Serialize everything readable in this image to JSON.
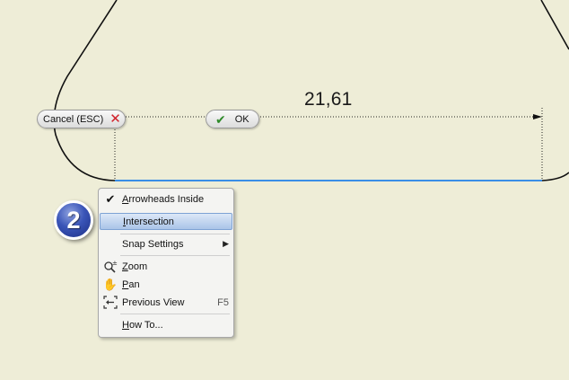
{
  "dimension": {
    "value": "21,61"
  },
  "buttons": {
    "cancel_label": "Cancel (ESC)",
    "ok_label": "OK"
  },
  "step_badge": {
    "number": "2"
  },
  "context_menu": {
    "items": [
      {
        "mnemonic": "A",
        "rest": "rrowheads Inside",
        "checked": true,
        "icon": "checkmark-icon"
      },
      {
        "mnemonic": "I",
        "rest": "ntersection",
        "highlighted": true
      },
      {
        "mnemonic": "",
        "rest": "Snap Settings",
        "submenu": true
      },
      {
        "mnemonic": "Z",
        "rest": "oom",
        "icon": "zoom-icon"
      },
      {
        "mnemonic": "P",
        "rest": "an",
        "icon": "pan-hand-icon"
      },
      {
        "mnemonic": "",
        "rest": "Previous View",
        "shortcut": "F5",
        "icon": "previous-view-icon"
      },
      {
        "mnemonic": "H",
        "rest": "ow To..."
      }
    ]
  },
  "colors": {
    "background": "#eeedd7",
    "selected_line": "#3a8ee6",
    "highlight": "#a9c4e8",
    "badge": "#2b44a8"
  }
}
